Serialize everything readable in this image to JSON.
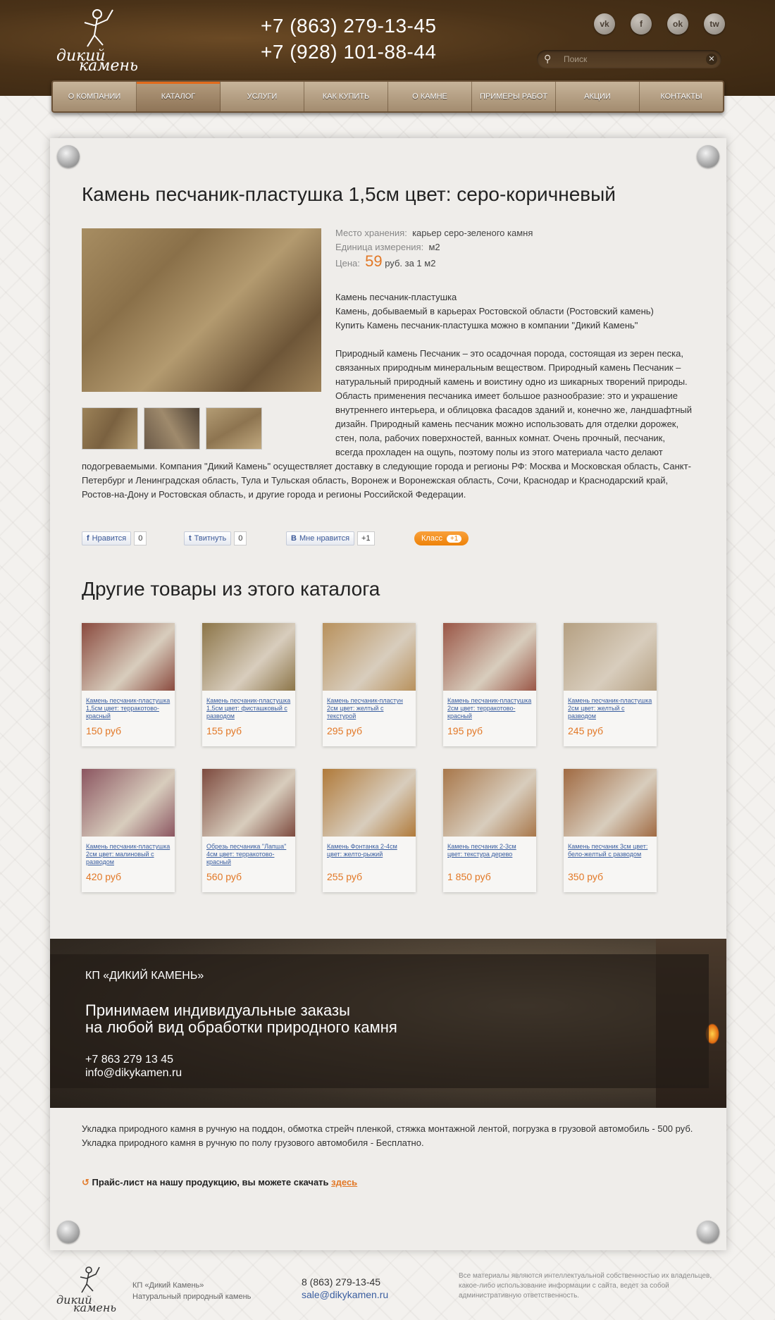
{
  "header": {
    "logo_text": "ДИКИЙ КАМЕНЬ",
    "phones": [
      "+7 (863) 279-13-45",
      "+7 (928) 101-88-44"
    ],
    "socials": [
      "vk",
      "f",
      "ok",
      "tw"
    ],
    "search": {
      "placeholder": "Поиск"
    }
  },
  "nav": [
    {
      "label": "О компании",
      "active": false
    },
    {
      "label": "Каталог",
      "active": true
    },
    {
      "label": "Услуги",
      "active": false
    },
    {
      "label": "Как купить",
      "active": false
    },
    {
      "label": "О камне",
      "active": false
    },
    {
      "label": "Примеры работ",
      "active": false
    },
    {
      "label": "Акции",
      "active": false
    },
    {
      "label": "Контакты",
      "active": false
    }
  ],
  "product": {
    "title": "Камень песчаник-пластушка 1,5см цвет: серо-коричневый",
    "storage_label": "Место хранения:",
    "storage_value": "карьер серо-зеленого камня",
    "unit_label": "Единица измерения:",
    "unit_value": "м2",
    "price_label": "Цена:",
    "price_value": "59",
    "price_suffix": "руб. за 1 м2",
    "intro": [
      "Камень песчаник-пластушка",
      "Камень, добываемый в карьерах Ростовской области (Ростовский камень)",
      "Купить Камень песчаник-пластушка можно в компании \"Дикий Камень\""
    ],
    "description": "Природный камень Песчаник – это осадочная порода, состоящая из зерен песка, связанных природным минеральным веществом. Природный камень Песчаник – натуральный природный камень и воистину одно из шикарных творений природы. Область применения песчаника имеет большое разнообразие: это и украшение внутреннего интерьера, и облицовка фасадов зданий и, конечно же, ландшафтный дизайн. Природный камень песчаник можно использовать для отделки дорожек, стен, пола, рабочих поверхностей, ванных комнат. Очень прочный, песчаник, всегда прохладен на ощупь, поэтому полы из этого материала часто делают подогреваемыми. Компания \"Дикий Камень\" осуществляет доставку в следующие города и регионы РФ: Москва и Московская область, Санкт-Петербург и Ленинградская область, Тула и Тульская область, Воронеж и Воронежская область, Сочи, Краснодар и Краснодарский край, Ростов-на-Дону и Ростовская область, и другие города и регионы Российской Федерации."
  },
  "social_buttons": {
    "fb_label": "Нравится",
    "fb_count": "0",
    "tw_label": "Твитнуть",
    "tw_count": "0",
    "vk_label": "Мне нравится",
    "vk_count": "+1",
    "ok_label": "Класс",
    "ok_count": "+1"
  },
  "other_title": "Другие товары из этого каталога",
  "other_products": [
    {
      "name": "Камень песчаник-пластушка 1,5см цвет: терракотово-красный",
      "price": "150 руб",
      "color": "#8a4a3e"
    },
    {
      "name": "Камень песчаник-пластушка 1,5см цвет: фисташковый с разводом",
      "price": "155 руб",
      "color": "#8c7548"
    },
    {
      "name": "Камень песчаник-пластун 2см цвет: желтый с текстурой",
      "price": "295 руб",
      "color": "#b8915c"
    },
    {
      "name": "Камень песчаник-пластушка 2см цвет: терракотово-красный",
      "price": "195 руб",
      "color": "#9a5646"
    },
    {
      "name": "Камень песчаник-пластушка 2см цвет: желтый с разводом",
      "price": "245 руб",
      "color": "#b5a082"
    },
    {
      "name": "Камень песчаник-пластушка 2см цвет: малиновый с разводом",
      "price": "420 руб",
      "color": "#8b5560"
    },
    {
      "name": "Обрезь песчаника \"Лапша\" 4см цвет: терракотово-красный",
      "price": "560 руб",
      "color": "#7d4a3e"
    },
    {
      "name": "Камень Фонтанка 2-4см цвет: желто-рыжий",
      "price": "255 руб",
      "color": "#b07a3a"
    },
    {
      "name": "Камень песчаник 2-3см цвет: текстура дерево",
      "price": "1 850 руб",
      "color": "#a8774a"
    },
    {
      "name": "Камень песчаник 3см цвет: бело-желтый с разводом",
      "price": "350 руб",
      "color": "#a06a42"
    }
  ],
  "banner": {
    "company": "КП «ДИКИЙ КАМЕНЬ»",
    "slogan_1": "Принимаем индивидуальные заказы",
    "slogan_2": "на любой вид обработки природного камня",
    "phone": "+7 863 279 13 45",
    "email": "info@dikykamen.ru"
  },
  "delivery": {
    "line1": "Укладка природного камня в ручную на поддон, обмотка стрейч пленкой, стяжка монтажной лентой, погрузка в грузовой автомобиль  -  500 руб.",
    "line2": "Укладка природного камня в ручную по полу грузового автомобиля -  Бесплатно."
  },
  "pricelist": {
    "text": "Прайс-лист на нашу продукцию, вы можете скачать",
    "link": "здесь"
  },
  "footer": {
    "company": "КП «Дикий Камень»",
    "tagline": "Натуральный природный камень",
    "phone": "8 (863) 279-13-45",
    "email": "sale@dikykamen.ru",
    "note": "Все материалы являются интеллектуальной собственностью их владельцев, какое-либо использование информации с сайта, ведет за собой административную ответственность."
  },
  "colors": {
    "accent": "#e27826",
    "link": "#3a5ea0",
    "header_bg": "#4a3218"
  }
}
